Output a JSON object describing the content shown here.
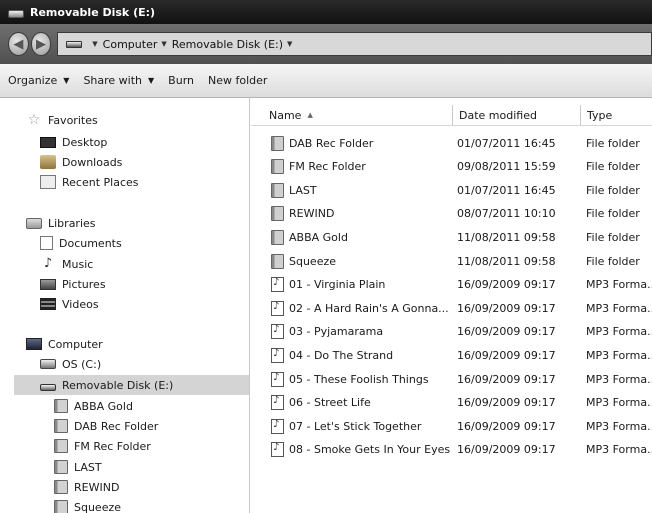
{
  "window": {
    "title": "Removable Disk (E:)"
  },
  "addressbar": {
    "crumbs": [
      "Computer",
      "Removable Disk (E:)"
    ]
  },
  "commandbar": {
    "organize": "Organize",
    "share_with": "Share with",
    "burn": "Burn",
    "new_folder": "New folder"
  },
  "navpane": {
    "favorites": {
      "label": "Favorites",
      "items": [
        "Desktop",
        "Downloads",
        "Recent Places"
      ]
    },
    "libraries": {
      "label": "Libraries",
      "items": [
        "Documents",
        "Music",
        "Pictures",
        "Videos"
      ]
    },
    "computer": {
      "label": "Computer",
      "drives": [
        "OS (C:)",
        "Removable Disk (E:)"
      ],
      "subfolders": [
        "ABBA Gold",
        "DAB Rec Folder",
        "FM Rec Folder",
        "LAST",
        "REWIND",
        "Squeeze"
      ]
    }
  },
  "filelist": {
    "columns": [
      "Name",
      "Date modified",
      "Type"
    ],
    "rows": [
      {
        "name": "DAB Rec Folder",
        "date": "01/07/2011 16:45",
        "type": "File folder",
        "icon": "folder-icon"
      },
      {
        "name": "FM Rec Folder",
        "date": "09/08/2011 15:59",
        "type": "File folder",
        "icon": "folder-icon"
      },
      {
        "name": "LAST",
        "date": "01/07/2011 16:45",
        "type": "File folder",
        "icon": "folder-icon"
      },
      {
        "name": "REWIND",
        "date": "08/07/2011 10:10",
        "type": "File folder",
        "icon": "folder-icon"
      },
      {
        "name": "ABBA Gold",
        "date": "11/08/2011 09:58",
        "type": "File folder",
        "icon": "folder-icon"
      },
      {
        "name": "Squeeze",
        "date": "11/08/2011 09:58",
        "type": "File folder",
        "icon": "folder-icon"
      },
      {
        "name": "01 - Virginia Plain",
        "date": "16/09/2009 09:17",
        "type": "MP3 Forma..",
        "icon": "mp3-file-icon"
      },
      {
        "name": "02 - A Hard Rain's A Gonna...",
        "date": "16/09/2009 09:17",
        "type": "MP3 Forma..",
        "icon": "mp3-file-icon"
      },
      {
        "name": "03 - Pyjamarama",
        "date": "16/09/2009 09:17",
        "type": "MP3 Forma..",
        "icon": "mp3-file-icon"
      },
      {
        "name": "04 - Do The Strand",
        "date": "16/09/2009 09:17",
        "type": "MP3 Forma..",
        "icon": "mp3-file-icon"
      },
      {
        "name": "05 - These Foolish Things",
        "date": "16/09/2009 09:17",
        "type": "MP3 Forma..",
        "icon": "mp3-file-icon"
      },
      {
        "name": "06 - Street Life",
        "date": "16/09/2009 09:17",
        "type": "MP3 Forma..",
        "icon": "mp3-file-icon"
      },
      {
        "name": "07 - Let's Stick Together",
        "date": "16/09/2009 09:17",
        "type": "MP3 Forma..",
        "icon": "mp3-file-icon"
      },
      {
        "name": "08 - Smoke Gets In Your Eyes",
        "date": "16/09/2009 09:17",
        "type": "MP3 Forma..",
        "icon": "mp3-file-icon"
      }
    ]
  }
}
